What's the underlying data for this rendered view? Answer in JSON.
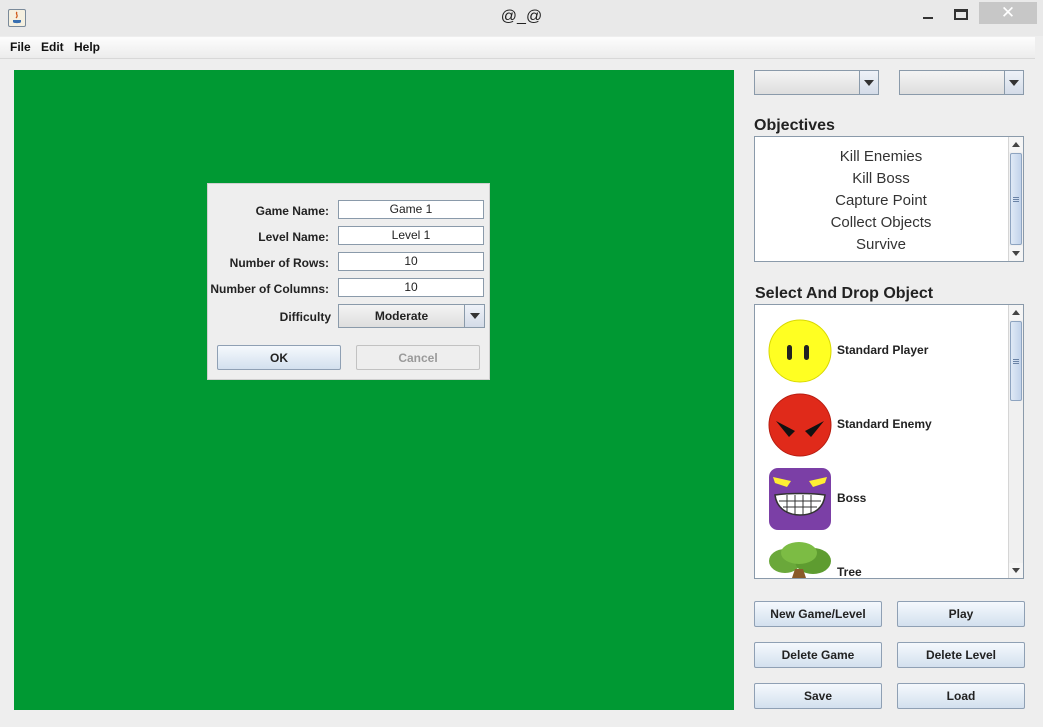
{
  "window": {
    "title": "@_@"
  },
  "menu": {
    "file": "File",
    "edit": "Edit",
    "help": "Help"
  },
  "canvas": {
    "background": "#009933"
  },
  "dialog": {
    "game_name_label": "Game Name:",
    "game_name_value": "Game 1",
    "level_name_label": "Level Name:",
    "level_name_value": "Level 1",
    "rows_label": "Number of Rows:",
    "rows_value": "10",
    "columns_label": "Number of Columns:",
    "columns_value": "10",
    "difficulty_label": "Difficulty",
    "difficulty_value": "Moderate",
    "ok_label": "OK",
    "cancel_label": "Cancel"
  },
  "objectives": {
    "title": "Objectives",
    "items": [
      "Kill Enemies",
      "Kill Boss",
      "Capture Point",
      "Collect Objects",
      "Survive"
    ]
  },
  "objects": {
    "title": "Select And Drop Object",
    "items": [
      {
        "label": "Standard Player",
        "icon": "yellow-smiley-icon"
      },
      {
        "label": "Standard Enemy",
        "icon": "red-angry-face-icon"
      },
      {
        "label": "Boss",
        "icon": "purple-boss-face-icon"
      },
      {
        "label": "Tree",
        "icon": "tree-icon"
      }
    ]
  },
  "buttons": {
    "new_game_level": "New Game/Level",
    "play": "Play",
    "delete_game": "Delete Game",
    "delete_level": "Delete Level",
    "save": "Save",
    "load": "Load"
  }
}
